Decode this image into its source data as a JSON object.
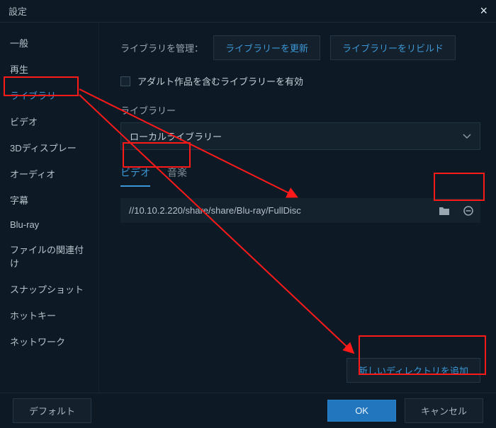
{
  "titlebar": {
    "title": "設定",
    "close": "×"
  },
  "sidebar": {
    "items": [
      {
        "label": "一般"
      },
      {
        "label": "再生"
      },
      {
        "label": "ライブラリー"
      },
      {
        "label": "ビデオ"
      },
      {
        "label": "3Dディスプレー"
      },
      {
        "label": "オーディオ"
      },
      {
        "label": "字幕"
      },
      {
        "label": "Blu-ray"
      },
      {
        "label": "ファイルの関連付け"
      },
      {
        "label": "スナップショット"
      },
      {
        "label": "ホットキー"
      },
      {
        "label": "ネットワーク"
      }
    ],
    "active_index": 2
  },
  "main": {
    "manage_label": "ライブラリを管理：",
    "refresh_btn": "ライブラリーを更新",
    "rebuild_btn": "ライブラリーをリビルド",
    "adult_checkbox_label": "アダルト作品を含むライブラリーを有効",
    "library_label": "ライブラリー",
    "dropdown_value": "ローカルライブラリー",
    "tabs": {
      "video": "ビデオ",
      "music": "音楽"
    },
    "path": "//10.10.2.220/share/share/Blu-ray/FullDisc",
    "add_dir_btn": "新しいディレクトリを追加"
  },
  "footer": {
    "default_btn": "デフォルト",
    "ok_btn": "OK",
    "cancel_btn": "キャンセル"
  }
}
